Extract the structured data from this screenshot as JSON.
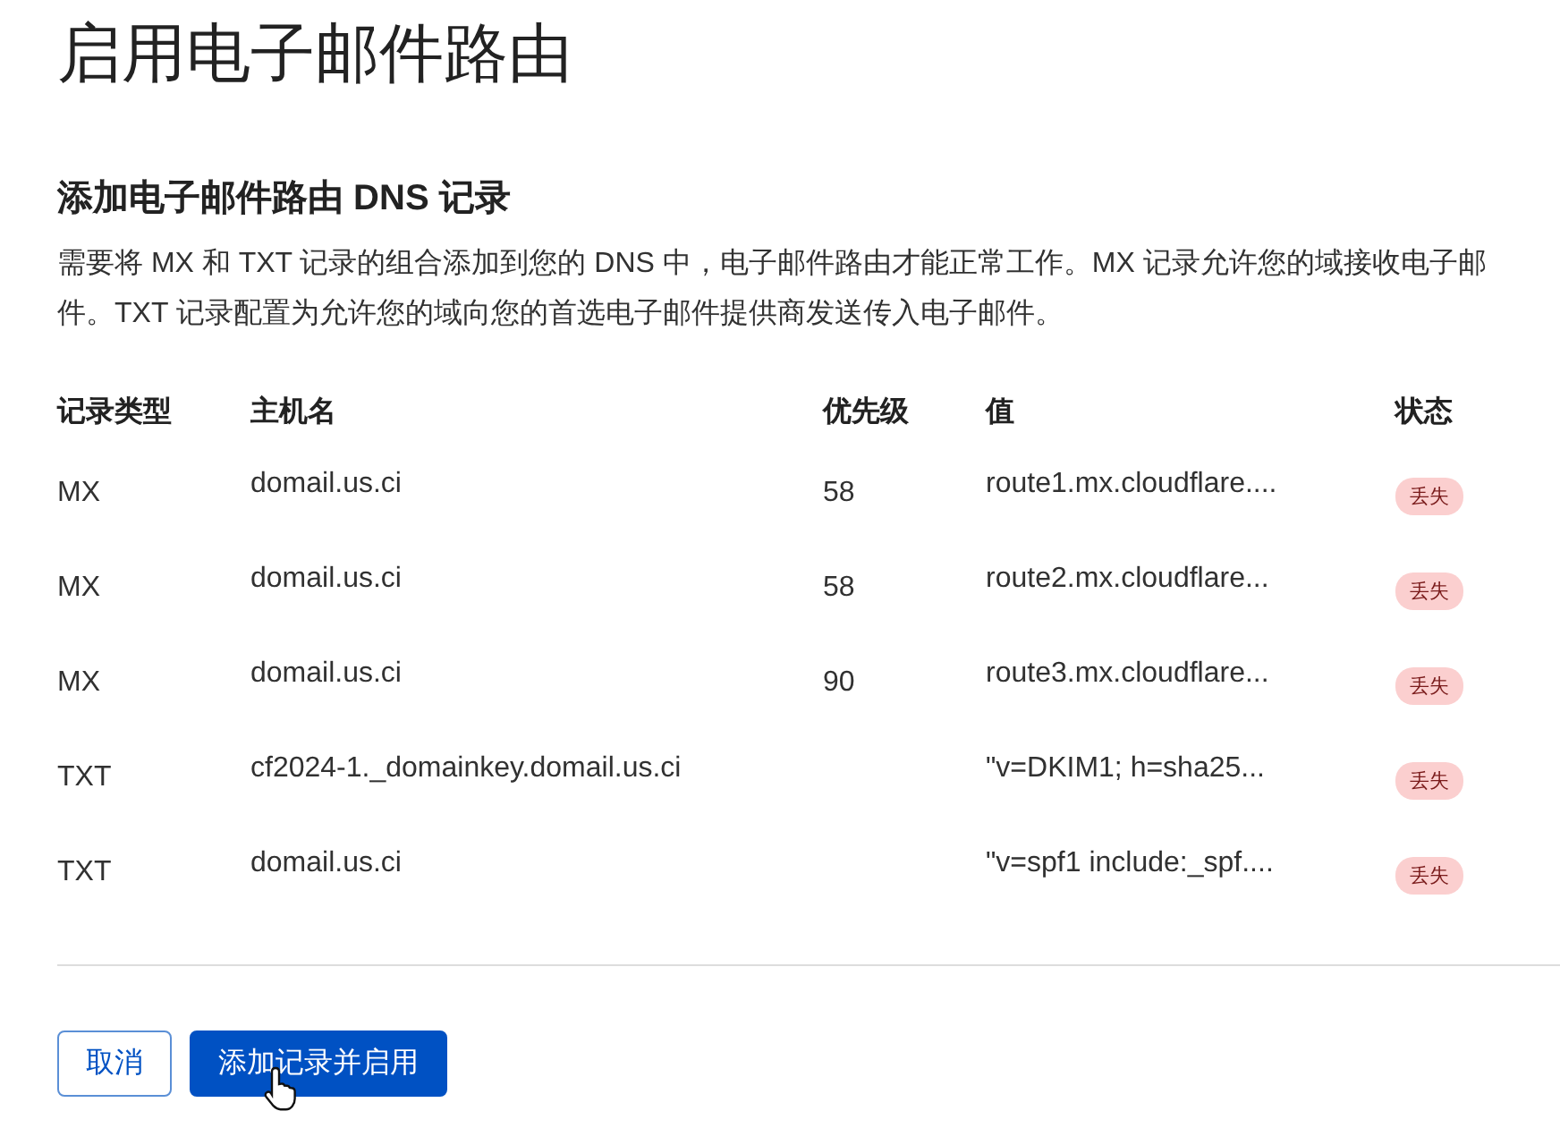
{
  "title": "启用电子邮件路由",
  "section": {
    "heading": "添加电子邮件路由 DNS 记录",
    "description": "需要将 MX 和 TXT 记录的组合添加到您的 DNS 中，电子邮件路由才能正常工作。MX 记录允许您的域接收电子邮件。TXT 记录配置为允许您的域向您的首选电子邮件提供商发送传入电子邮件。"
  },
  "table": {
    "columns": [
      "记录类型",
      "主机名",
      "优先级",
      "值",
      "状态"
    ],
    "rows": [
      {
        "type": "MX",
        "host": "domail.us.ci",
        "priority": "58",
        "value": "route1.mx.cloudflare....",
        "status": "丢失"
      },
      {
        "type": "MX",
        "host": "domail.us.ci",
        "priority": "58",
        "value": "route2.mx.cloudflare...",
        "status": "丢失"
      },
      {
        "type": "MX",
        "host": "domail.us.ci",
        "priority": "90",
        "value": "route3.mx.cloudflare...",
        "status": "丢失"
      },
      {
        "type": "TXT",
        "host": "cf2024-1._domainkey.domail.us.ci",
        "value": "\"v=DKIM1; h=sha25...",
        "status": "丢失"
      },
      {
        "type": "TXT",
        "host": "domail.us.ci",
        "value": "\"v=spf1 include:_spf....",
        "status": "丢失"
      }
    ]
  },
  "buttons": [
    {
      "label": "取消",
      "kind": "secondary"
    },
    {
      "label": "添加记录并启用",
      "kind": "primary"
    }
  ]
}
